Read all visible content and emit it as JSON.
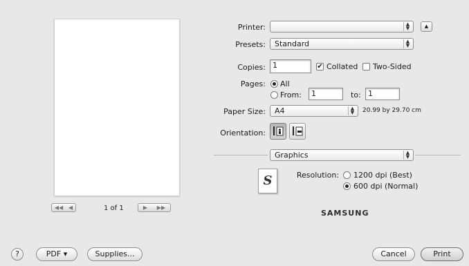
{
  "preview": {
    "page_indicator": "1 of 1",
    "first_glyph": "◀◀",
    "prev_glyph": "◀",
    "next_glyph": "▶",
    "last_glyph": "▶▶"
  },
  "printer": {
    "label": "Printer:",
    "value": ""
  },
  "presets": {
    "label": "Presets:",
    "value": "Standard"
  },
  "copies": {
    "label": "Copies:",
    "value": "1",
    "collated_label": "Collated",
    "collated_checked": true,
    "two_sided_label": "Two-Sided",
    "two_sided_checked": false
  },
  "pages": {
    "label": "Pages:",
    "all_label": "All",
    "from_label": "From:",
    "from_value": "1",
    "to_label": "to:",
    "to_value": "1",
    "selected": "all"
  },
  "paper_size": {
    "label": "Paper Size:",
    "value": "A4",
    "dimensions": "20.99 by 29.70 cm"
  },
  "orientation": {
    "label": "Orientation:",
    "selected": "portrait"
  },
  "panel_select": {
    "value": "Graphics"
  },
  "resolution": {
    "label": "Resolution:",
    "options": [
      "1200 dpi (Best)",
      "600 dpi (Normal)"
    ],
    "selected_index": 1
  },
  "brand": "SAMSUNG",
  "logo_letter": "S",
  "footer": {
    "help_label": "?",
    "pdf_label": "PDF ▾",
    "supplies_label": "Supplies...",
    "cancel_label": "Cancel",
    "print_label": "Print"
  }
}
